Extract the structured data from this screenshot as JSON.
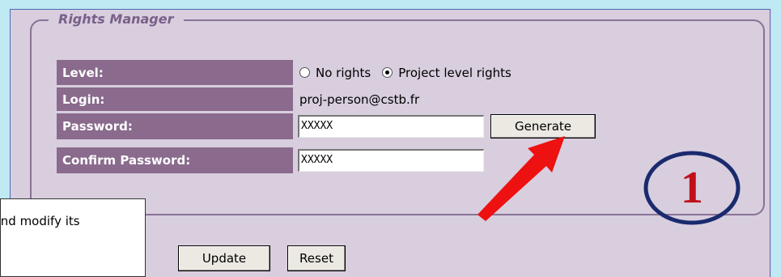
{
  "fieldset": {
    "legend": "Rights Manager"
  },
  "rows": {
    "level_label": "Level:",
    "login_label": "Login:",
    "password_label": "Password:",
    "confirm_label": "Confirm Password:"
  },
  "level_options": [
    {
      "label": "No rights",
      "checked": false
    },
    {
      "label": "Project level rights",
      "checked": true
    }
  ],
  "login_value": "proj-person@cstb.fr",
  "password_value": "XXXXX",
  "confirm_value": "XXXXX",
  "buttons": {
    "generate": "Generate",
    "update": "Update",
    "reset": "Reset"
  },
  "tooltip_text": "s and modify its",
  "annotation": {
    "number": "1",
    "color": "#1a2a6e"
  },
  "arrow": {
    "color": "#ee1111"
  }
}
